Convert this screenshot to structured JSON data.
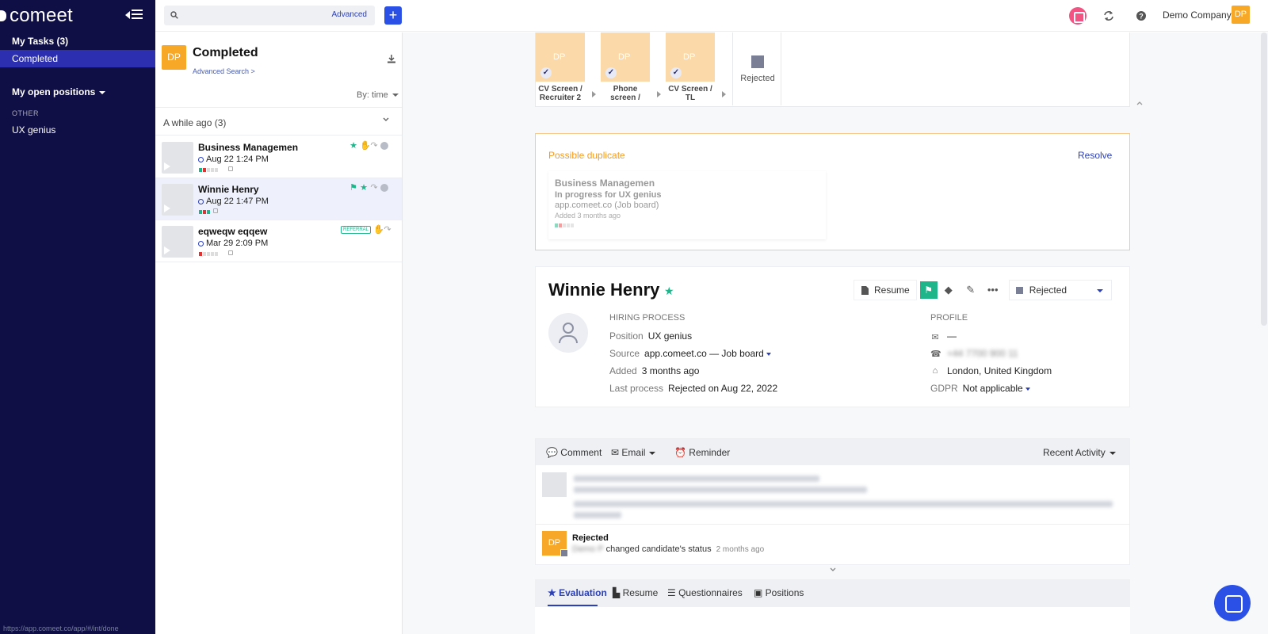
{
  "sidebar": {
    "logo": "comeet",
    "items": [
      {
        "label": "My Tasks (3)"
      },
      {
        "label": "Completed"
      },
      {
        "label": "My open positions"
      },
      {
        "label": "UX genius"
      }
    ],
    "section_other": "OTHER",
    "status_url": "https://app.comeet.co/app/#/int/done"
  },
  "topbar": {
    "search_placeholder": "",
    "advanced_label": "Advanced",
    "add_label": "+",
    "company": "Demo Company",
    "avatar_initials": "DP"
  },
  "list": {
    "avatar_initials": "DP",
    "title": "Completed",
    "advanced_search": "Advanced Search >",
    "sort_label": "By: time",
    "group_label": "A while ago (3)",
    "candidates": [
      {
        "name": "Business Managemen",
        "date": "Aug 22 1:24 PM"
      },
      {
        "name": "Winnie Henry",
        "date": "Aug 22 1:47 PM"
      },
      {
        "name": "eqweqw eqqew",
        "date": "Mar 29 2:09 PM",
        "badge": "REFERRAL"
      }
    ]
  },
  "pipeline": {
    "stages": [
      {
        "initials": "DP",
        "label": "CV Screen / Recruiter 2"
      },
      {
        "initials": "DP",
        "label": "Phone screen /"
      },
      {
        "initials": "DP",
        "label": "CV Screen / TL"
      }
    ],
    "rejected_label": "Rejected"
  },
  "duplicate": {
    "title": "Possible duplicate",
    "resolve": "Resolve",
    "name": "Business Managemen",
    "process": "In progress for UX genius",
    "source": "app.comeet.co (Job board)",
    "added": "Added 3 months ago"
  },
  "candidate": {
    "name": "Winnie Henry",
    "resume_btn": "Resume",
    "status": "Rejected",
    "hiring_title": "HIRING PROCESS",
    "position_k": "Position",
    "position_v": "UX genius",
    "source_k": "Source",
    "source_v": "app.comeet.co — Job board",
    "added_k": "Added",
    "added_v": "3 months ago",
    "last_k": "Last process",
    "last_v": "Rejected on Aug 22, 2022",
    "profile_title": "PROFILE",
    "email": "—",
    "phone": "+44 7700 900 11",
    "location": "London, United Kingdom",
    "gdpr_k": "GDPR",
    "gdpr_v": "Not applicable"
  },
  "activity": {
    "comment": "Comment",
    "email": "Email",
    "reminder": "Reminder",
    "recent": "Recent Activity",
    "event_title": "Rejected",
    "event_user": "Demo P",
    "event_text": "changed candidate's status",
    "event_time": "2 months ago",
    "event_initials": "DP"
  },
  "tabs": {
    "evaluation": "Evaluation",
    "resume": "Resume",
    "questionnaires": "Questionnaires",
    "positions": "Positions"
  },
  "colors": {
    "sidebar": "#0f0f45",
    "accent": "#2b50e6",
    "brand_orange": "#f7a827",
    "green": "#1fb58b"
  }
}
